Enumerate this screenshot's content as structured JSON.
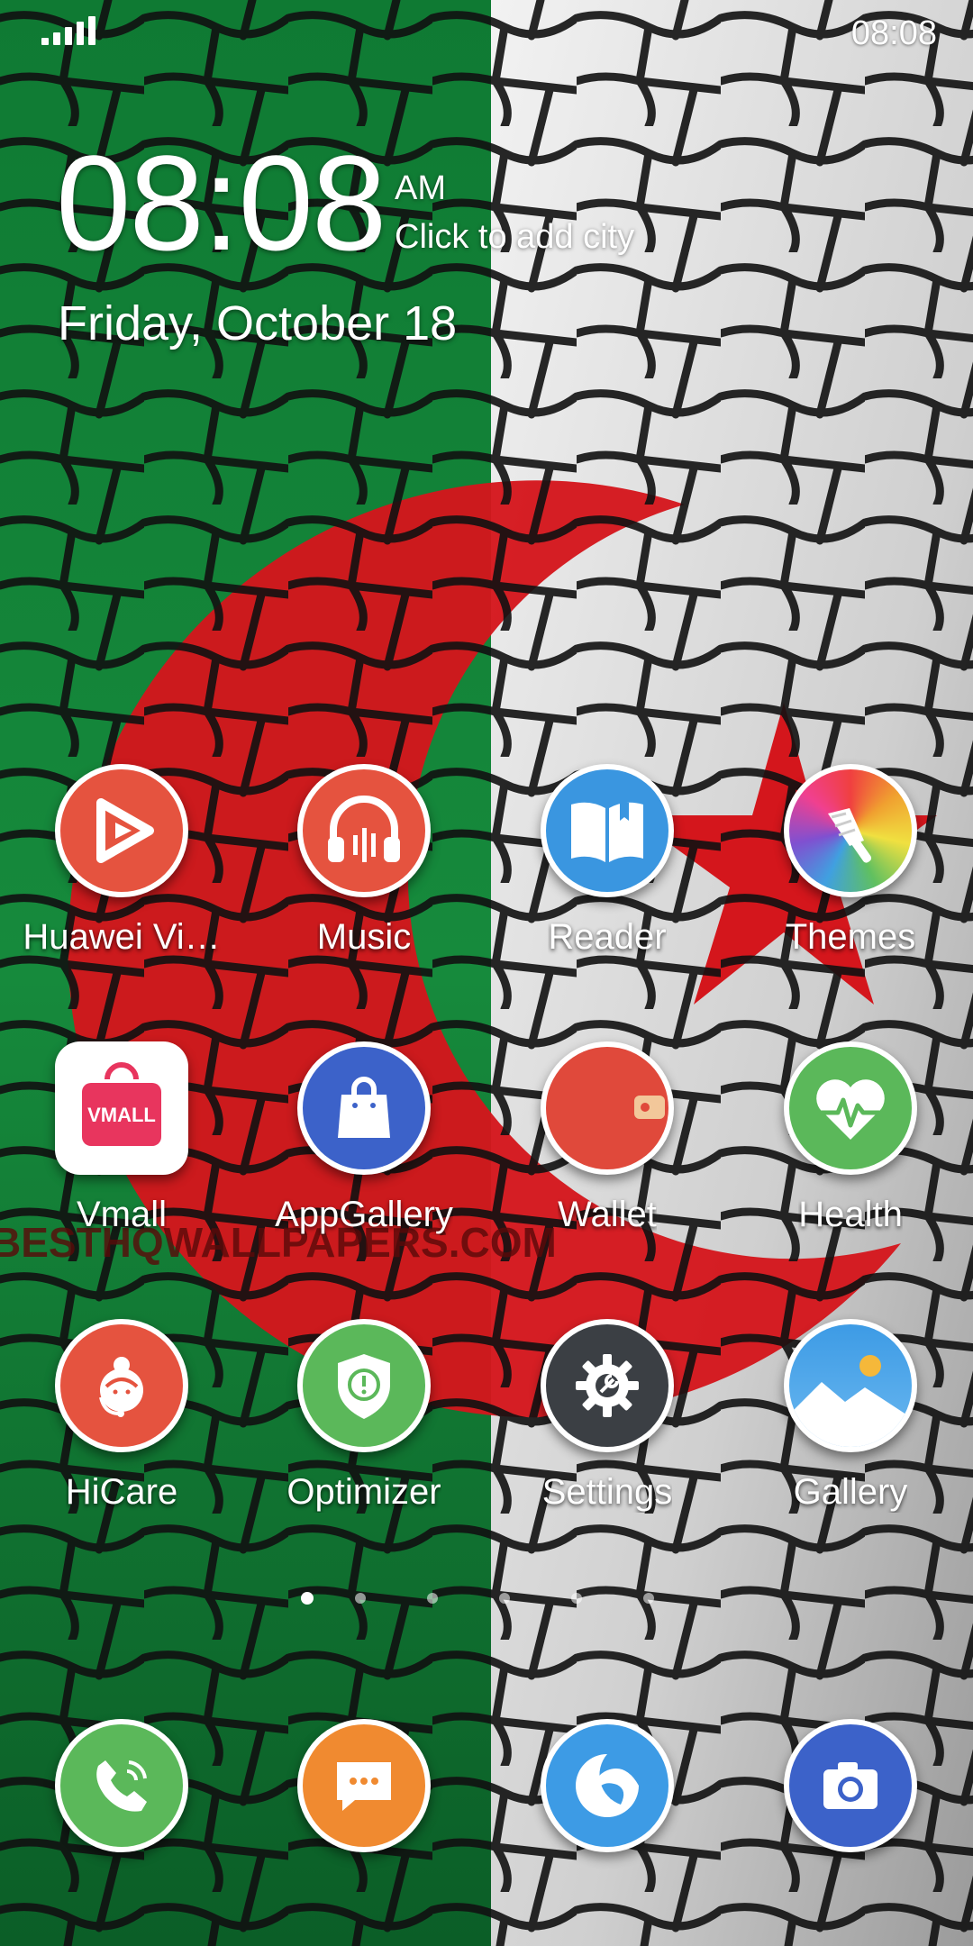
{
  "status_bar": {
    "time": "08:08",
    "signal_icon": "signal-bars-icon"
  },
  "clock_widget": {
    "time": "08:08",
    "ampm": "AM",
    "city_prompt": "Click to add city",
    "date": "Friday, October 18"
  },
  "apps": [
    {
      "label": "Huawei Vi…",
      "icon": "huawei-video-icon",
      "color": "#e5533f"
    },
    {
      "label": "Music",
      "icon": "music-headphones-icon",
      "color": "#e5533f"
    },
    {
      "label": "Reader",
      "icon": "reader-book-icon",
      "color": "#3a96e0"
    },
    {
      "label": "Themes",
      "icon": "themes-brush-icon",
      "color": "#f0a030"
    },
    {
      "label": "Vmall",
      "icon": "vmall-bag-icon",
      "color": "#e8355e",
      "icon_text": "VMALL"
    },
    {
      "label": "AppGallery",
      "icon": "appgallery-bag-icon",
      "color": "#3c62c9"
    },
    {
      "label": "Wallet",
      "icon": "wallet-icon",
      "color": "#e0493b"
    },
    {
      "label": "Health",
      "icon": "health-heart-icon",
      "color": "#5bb85a"
    },
    {
      "label": "HiCare",
      "icon": "hicare-agent-icon",
      "color": "#e5533f"
    },
    {
      "label": "Optimizer",
      "icon": "optimizer-shield-icon",
      "color": "#5bb85a"
    },
    {
      "label": "Settings",
      "icon": "settings-gear-icon",
      "color": "#3b3f44"
    },
    {
      "label": "Gallery",
      "icon": "gallery-landscape-icon",
      "color": "#3d9be5"
    }
  ],
  "page_indicator": {
    "pages": 6,
    "current": 1
  },
  "dock": [
    {
      "icon": "phone-icon",
      "color": "#5bb85a"
    },
    {
      "icon": "messages-icon",
      "color": "#f08a30"
    },
    {
      "icon": "browser-icon",
      "color": "#3d9be5"
    },
    {
      "icon": "camera-icon",
      "color": "#3c62c9"
    }
  ],
  "wallpaper": {
    "watermark": "BESTHQWALLPAPERS.COM",
    "flag_green": "#12823a",
    "flag_white": "#d9d9d9",
    "flag_red": "#d4161c"
  }
}
